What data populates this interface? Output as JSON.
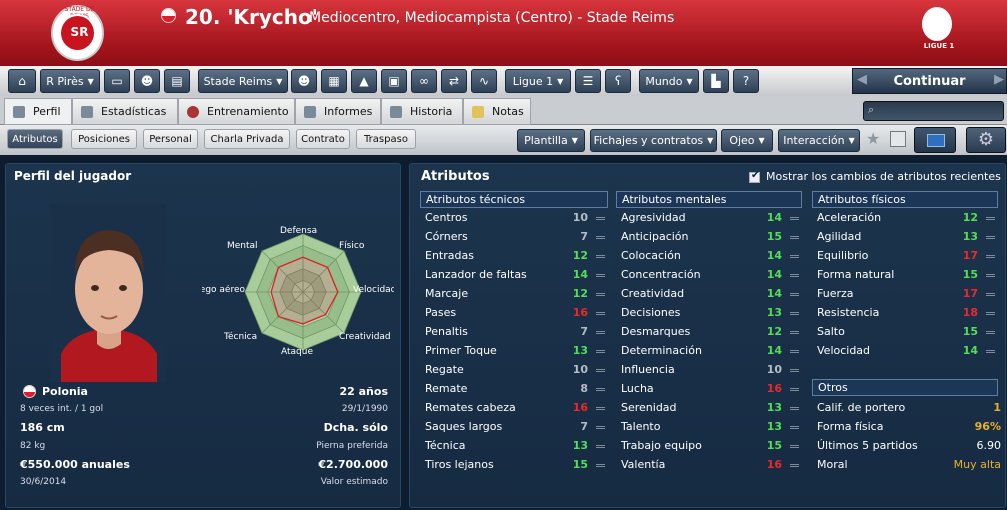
{
  "header": {
    "crest_text": "STADE DE REIMS",
    "crest_letters": "SR",
    "title": "20. 'Krycho'",
    "subtitle": "Mediocentro, Mediocampista (Centro) - Stade Reims",
    "league_label": "LIGUE 1",
    "colors": {
      "primary": "#a3141c",
      "accent": "#d8353d"
    }
  },
  "toolbar": {
    "manager": "R Pirès",
    "club": "Stade Reims",
    "league": "Ligue 1",
    "world": "Mundo",
    "continue": "Continuar"
  },
  "tabs": [
    {
      "label": "Perfil"
    },
    {
      "label": "Estadísticas"
    },
    {
      "label": "Entrenamiento"
    },
    {
      "label": "Informes"
    },
    {
      "label": "Historia"
    },
    {
      "label": "Notas"
    }
  ],
  "subtabs": [
    {
      "label": "Atributos"
    },
    {
      "label": "Posiciones"
    },
    {
      "label": "Personal"
    },
    {
      "label": "Charla Privada"
    },
    {
      "label": "Contrato"
    },
    {
      "label": "Traspaso"
    }
  ],
  "actions": {
    "plantilla": "Plantilla",
    "fichajes": "Fichajes y contratos",
    "ojeo": "Ojeo",
    "interaccion": "Interacción"
  },
  "profile": {
    "heading": "Perfil del jugador",
    "radar_labels": [
      "Defensa",
      "Físico",
      "Velocidad",
      "Creatividad",
      "Ataque",
      "Técnica",
      "Juego aéreo",
      "Mental"
    ],
    "radar_values": [
      0.6,
      0.6,
      0.6,
      0.55,
      0.55,
      0.6,
      0.55,
      0.6
    ],
    "nation": "Polonia",
    "caps": "8 veces int. / 1 gol",
    "age": "22 años",
    "dob": "29/1/1990",
    "height": "186 cm",
    "foot": "Dcha. sólo",
    "weight": "82 kg",
    "foot_label": "Pierna preferida",
    "wage": "€550.000 anuales",
    "value": "€2.700.000",
    "contract": "30/6/2014",
    "value_label": "Valor estimado"
  },
  "attributes": {
    "heading": "Atributos",
    "show_changes": "Mostrar los cambios de atributos recientes",
    "technical_title": "Atributos técnicos",
    "mental_title": "Atributos mentales",
    "physical_title": "Atributos físicos",
    "others_title": "Otros",
    "technical": [
      {
        "name": "Centros",
        "value": "10"
      },
      {
        "name": "Córners",
        "value": "7"
      },
      {
        "name": "Entradas",
        "value": "12"
      },
      {
        "name": "Lanzador de faltas",
        "value": "14"
      },
      {
        "name": "Marcaje",
        "value": "12"
      },
      {
        "name": "Pases",
        "value": "16"
      },
      {
        "name": "Penaltis",
        "value": "7"
      },
      {
        "name": "Primer Toque",
        "value": "13"
      },
      {
        "name": "Regate",
        "value": "10"
      },
      {
        "name": "Remate",
        "value": "8"
      },
      {
        "name": "Remates cabeza",
        "value": "16"
      },
      {
        "name": "Saques largos",
        "value": "7"
      },
      {
        "name": "Técnica",
        "value": "13"
      },
      {
        "name": "Tiros lejanos",
        "value": "15"
      }
    ],
    "mental": [
      {
        "name": "Agresividad",
        "value": "14"
      },
      {
        "name": "Anticipación",
        "value": "15"
      },
      {
        "name": "Colocación",
        "value": "14"
      },
      {
        "name": "Concentración",
        "value": "14"
      },
      {
        "name": "Creatividad",
        "value": "14"
      },
      {
        "name": "Decisiones",
        "value": "13"
      },
      {
        "name": "Desmarques",
        "value": "12"
      },
      {
        "name": "Determinación",
        "value": "14"
      },
      {
        "name": "Influencia",
        "value": "10"
      },
      {
        "name": "Lucha",
        "value": "16"
      },
      {
        "name": "Serenidad",
        "value": "13"
      },
      {
        "name": "Talento",
        "value": "13"
      },
      {
        "name": "Trabajo equipo",
        "value": "15"
      },
      {
        "name": "Valentía",
        "value": "16"
      }
    ],
    "physical": [
      {
        "name": "Aceleración",
        "value": "12"
      },
      {
        "name": "Agilidad",
        "value": "13"
      },
      {
        "name": "Equilibrio",
        "value": "17"
      },
      {
        "name": "Forma natural",
        "value": "15"
      },
      {
        "name": "Fuerza",
        "value": "17"
      },
      {
        "name": "Resistencia",
        "value": "18"
      },
      {
        "name": "Salto",
        "value": "15"
      },
      {
        "name": "Velocidad",
        "value": "14"
      }
    ],
    "others": [
      {
        "name": "Calif. de portero",
        "value": "1"
      },
      {
        "name": "Forma física",
        "value": "96%"
      },
      {
        "name": "Últimos 5 partidos",
        "value": "6.90"
      },
      {
        "name": "Moral",
        "value": "Muy alta"
      }
    ]
  }
}
